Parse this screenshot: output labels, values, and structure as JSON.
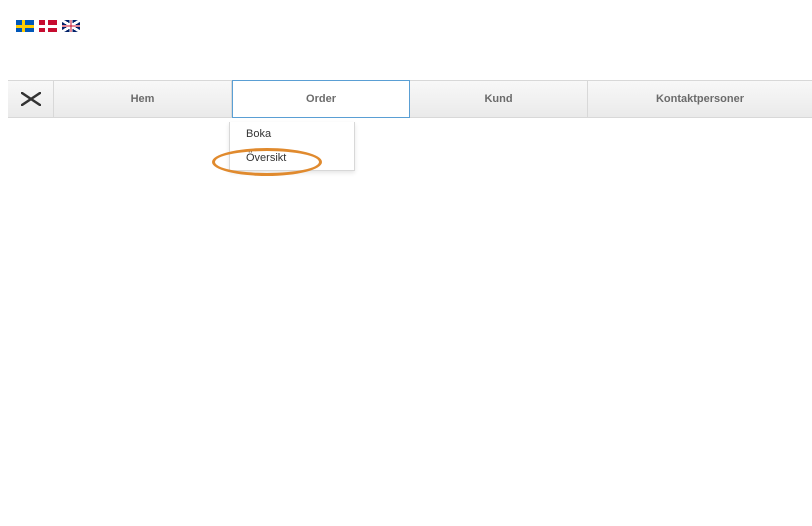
{
  "flags": [
    {
      "name": "swedish-flag"
    },
    {
      "name": "danish-flag"
    },
    {
      "name": "uk-flag"
    }
  ],
  "nav": {
    "tabs": [
      {
        "label": "Hem",
        "active": false
      },
      {
        "label": "Order",
        "active": true
      },
      {
        "label": "Kund",
        "active": false
      },
      {
        "label": "Kontaktpersoner",
        "active": false
      }
    ]
  },
  "dropdown": {
    "items": [
      {
        "label": "Boka"
      },
      {
        "label": "Översikt"
      }
    ]
  }
}
